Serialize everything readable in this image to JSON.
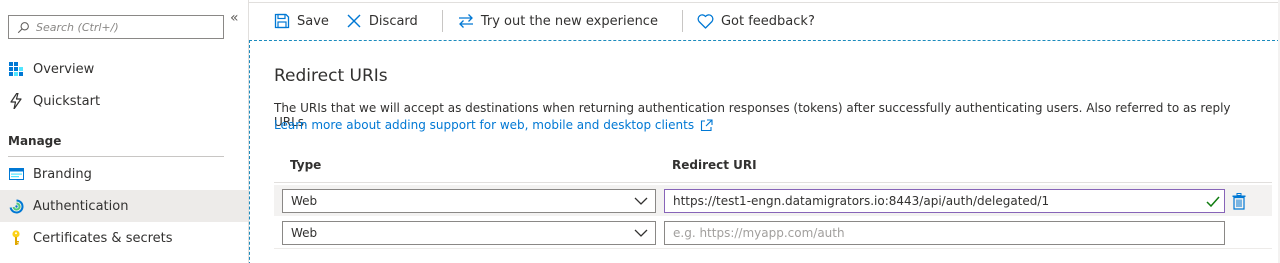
{
  "sidebar": {
    "search_placeholder": "Search (Ctrl+/)",
    "collapse_glyph": "«",
    "items": [
      {
        "label": "Overview",
        "icon": "overview-grid-icon"
      },
      {
        "label": "Quickstart",
        "icon": "lightning-icon"
      }
    ],
    "section": "Manage",
    "manage_items": [
      {
        "label": "Branding",
        "icon": "branding-icon"
      },
      {
        "label": "Authentication",
        "icon": "authentication-icon",
        "active": true
      },
      {
        "label": "Certificates & secrets",
        "icon": "key-icon"
      }
    ]
  },
  "toolbar": {
    "save": "Save",
    "discard": "Discard",
    "try_new": "Try out the new experience",
    "feedback": "Got feedback?"
  },
  "main": {
    "title": "Redirect URIs",
    "description": "The URIs that we will accept as destinations when returning authentication responses (tokens) after successfully authenticating users. Also referred to as reply URLs.",
    "learn_more": "Learn more about adding support for web, mobile and desktop clients",
    "columns": {
      "type": "Type",
      "uri": "Redirect URI"
    },
    "rows": [
      {
        "type": "Web",
        "uri": "https://test1-engn.datamigrators.io:8443/api/auth/delegated/1",
        "placeholder": ""
      },
      {
        "type": "Web",
        "uri": "",
        "placeholder": "e.g. https://myapp.com/auth"
      }
    ]
  },
  "colors": {
    "accent": "#0078d4",
    "focus_border": "#8764b8",
    "valid_check": "#107c10",
    "dashed_border": "#1b8bbd"
  }
}
